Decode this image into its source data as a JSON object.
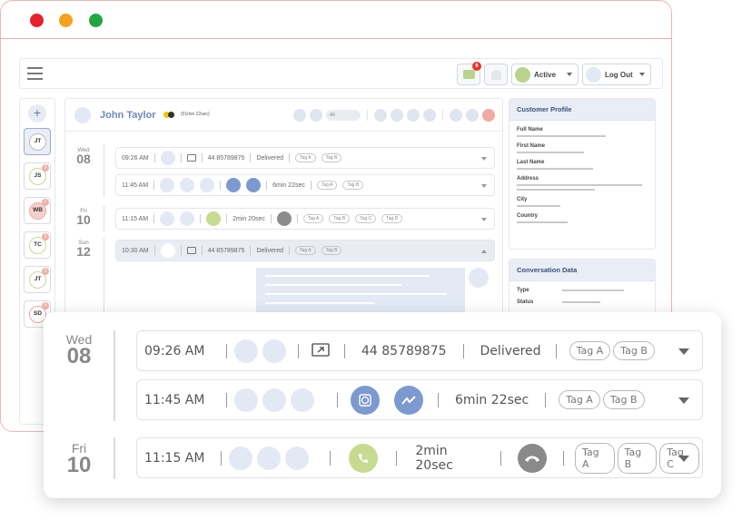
{
  "colors": {
    "accent": "#6b88bd",
    "window_border": "#e8b9b0",
    "active_dot": "#b9d38a",
    "call_green": "#c6da90",
    "call_blue": "#7d9ad0",
    "call_grey": "#8a8a8a"
  },
  "topbar": {
    "message_badge": "6",
    "status_label": "Active",
    "logout_label": "Log Out"
  },
  "contacts": [
    {
      "initials": "JT",
      "badge": ""
    },
    {
      "initials": "JS",
      "badge": "5"
    },
    {
      "initials": "WB",
      "badge": "7"
    },
    {
      "initials": "TC",
      "badge": "3"
    },
    {
      "initials": "JT",
      "badge": "3"
    },
    {
      "initials": "SD",
      "badge": "5"
    }
  ],
  "conversation": {
    "name": "John Taylor",
    "timer": "(01min 22sec)",
    "filter": "All"
  },
  "days": [
    {
      "weekday": "Wed",
      "day": "08"
    },
    {
      "weekday": "Fri",
      "day": "10"
    },
    {
      "weekday": "Sun",
      "day": "12"
    }
  ],
  "rows": [
    {
      "time": "09:26 AM",
      "detail": "44 85789875",
      "status": "Delivered",
      "tags": [
        "Tag A",
        "Tag B"
      ]
    },
    {
      "time": "11:45 AM",
      "detail": "6min 22sec",
      "tags": [
        "Tag A",
        "Tag B"
      ]
    },
    {
      "time": "11:15 AM",
      "detail": "2min 20sec",
      "tags": [
        "Tag A",
        "Tag B",
        "Tag C",
        "Tag D"
      ]
    },
    {
      "time": "10:30 AM",
      "detail": "44 85789875",
      "status": "Delivered",
      "tags": [
        "Tag A",
        "Tag B"
      ]
    }
  ],
  "customer_profile": {
    "title": "Customer Profile",
    "fields": [
      "Full Name",
      "First Name",
      "Last Name",
      "Address",
      "City",
      "Country"
    ]
  },
  "conversation_data": {
    "title": "Conversation Data",
    "fields": [
      "Type",
      "Status"
    ]
  },
  "zoom": {
    "rows": [
      {
        "time": "09:26 AM",
        "detail": "44 85789875",
        "status": "Delivered",
        "tags": [
          "Tag A",
          "Tag B"
        ]
      },
      {
        "time": "11:45 AM",
        "detail": "6min 22sec",
        "tags": [
          "Tag A",
          "Tag B"
        ]
      },
      {
        "time": "11:15 AM",
        "detail": "2min 20sec",
        "tags": [
          "Tag A",
          "Tag B",
          "Tag C"
        ]
      }
    ]
  }
}
